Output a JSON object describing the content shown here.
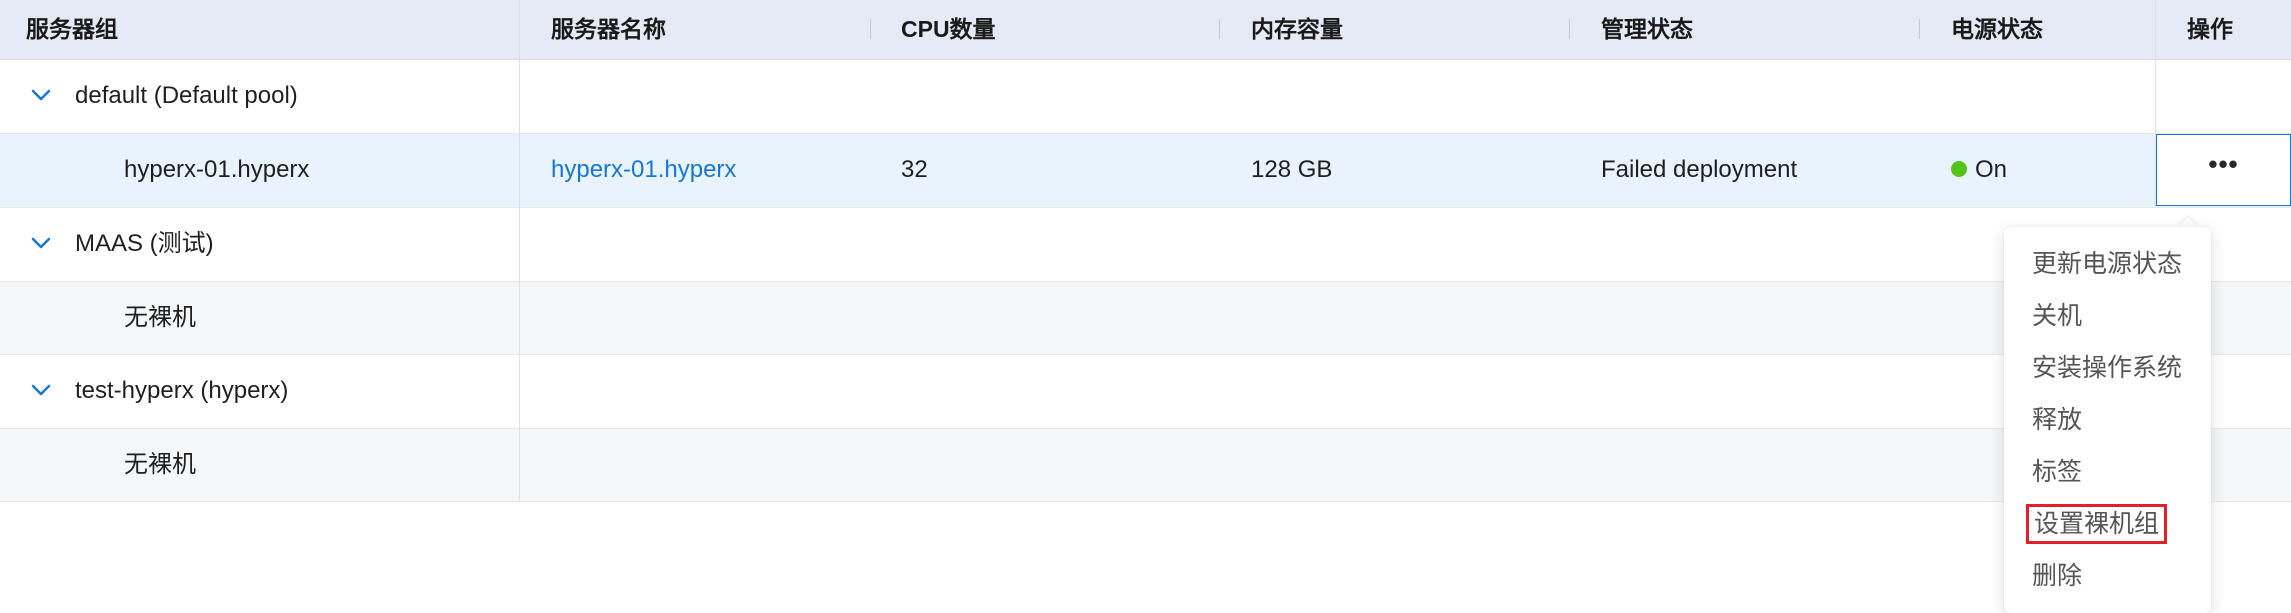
{
  "columns": [
    "服务器组",
    "服务器名称",
    "CPU数量",
    "内存容量",
    "管理状态",
    "电源状态",
    "操作"
  ],
  "groups": [
    {
      "name": "default (Default pool)",
      "machine": {
        "group_cell": "hyperx-01.hyperx",
        "name": "hyperx-01.hyperx",
        "cpu": "32",
        "memory": "128 GB",
        "status": "Failed deployment",
        "power": "On",
        "more": "•••"
      }
    },
    {
      "name": "MAAS (测试)",
      "empty_label": "无裸机"
    },
    {
      "name": "test-hyperx (hyperx)",
      "empty_label": "无裸机"
    }
  ],
  "action_menu": {
    "items": [
      "更新电源状态",
      "关机",
      "安装操作系统",
      "释放",
      "标签",
      "设置裸机组",
      "删除"
    ],
    "highlighted_item": "设置裸机组"
  },
  "colors": {
    "header_bg": "#e6eaf7",
    "selected_row_bg": "#e8f3fd",
    "link": "#1677d2",
    "power_on": "#52c41a",
    "highlight_border": "#e0202a"
  }
}
